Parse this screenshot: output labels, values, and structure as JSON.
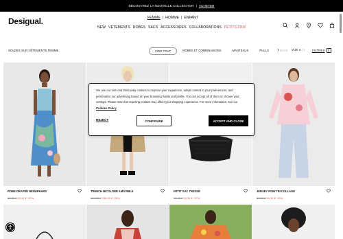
{
  "promo": {
    "text": "DÉCOUVREZ LA NOUVELLE COLLECTION",
    "separator": "|",
    "link": "ACHETER"
  },
  "header": {
    "logo": "Desigual.",
    "gender_tabs": [
      {
        "label": "FEMME",
        "active": true
      },
      {
        "label": "|",
        "active": false
      },
      {
        "label": "HOMME",
        "active": false
      },
      {
        "label": "|",
        "active": false
      },
      {
        "label": "ENFANT",
        "active": false
      }
    ],
    "nav": [
      "NEW",
      "VÊTEMENTS",
      "ROBES",
      "SACS",
      "ACCESSOIRES",
      "COLLABORATIONS",
      "PETITS PRIX"
    ],
    "icons": [
      "search-icon",
      "user-icon",
      "location-icon",
      "heart-icon",
      "bag-icon"
    ]
  },
  "filters": {
    "breadcrumb": "SOLDES SUR VÊTEMENTS FEMME",
    "categories": [
      "VOIR TOUT",
      "ROBES ET COMBINAISONS",
      "MANTEAUX",
      "PULLS",
      "BASK"
    ],
    "view_label": "VUE",
    "view_options": [
      "4",
      "|",
      "6"
    ],
    "filters_label": "FILTRES",
    "filters_count": "0"
  },
  "products": [
    {
      "name": "ROBE DRAPÉE NÉNUPHARS",
      "old_price": "89,95 €",
      "new_price": "60,92 € -32%"
    },
    {
      "name": "TRENCH BICOLORE AMOVIBLE",
      "old_price": "189,95 €",
      "new_price": "135,92 € -28%"
    },
    {
      "name": "PETIT SAC TRESSÉ",
      "old_price": "79,95 €",
      "new_price": "50,36 € -37%"
    },
    {
      "name": "JERSEY POINT'IN COLLAGE",
      "old_price": "89,95 €",
      "new_price": "60,36 € -33%"
    }
  ],
  "cookie": {
    "text": "We use our own and third-party cookies to improve your experience, adapt content to your preferences, and personalize our advertising based on your browsing habits and profile. You can accept all of them or choose your settings. Please note that rejecting cookies may affect your shopping experience. For more information, see our",
    "policy_link": "Cookies Policy",
    "reject": "REJECT",
    "configure": "CONFIGURE",
    "accept": "ACCEPT AND CLOSE"
  },
  "colors": {
    "sale": "#d9534f",
    "primary": "#000000"
  }
}
